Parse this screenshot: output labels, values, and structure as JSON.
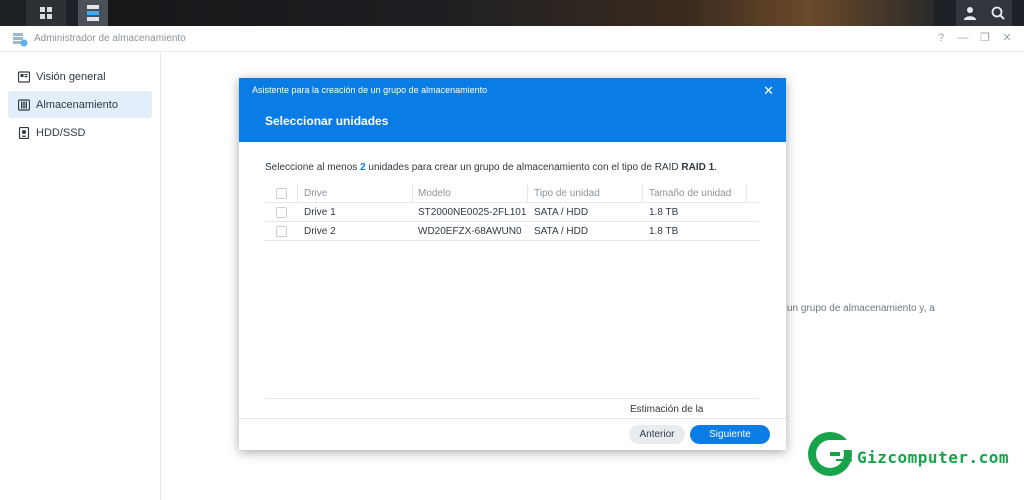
{
  "window": {
    "title": "Administrador de almacenamiento",
    "controls": [
      "?",
      "—",
      "❐",
      "✕"
    ]
  },
  "sidebar": {
    "items": [
      {
        "label": "Visión general",
        "icon": "overview-icon",
        "active": false
      },
      {
        "label": "Almacenamiento",
        "icon": "storage-icon",
        "active": true
      },
      {
        "label": "HDD/SSD",
        "icon": "disk-icon",
        "active": false
      }
    ]
  },
  "main": {
    "background_text": "un grupo de almacenamiento y, a"
  },
  "wizard": {
    "title": "Asistente para la creación de un grupo de almacenamiento",
    "step_title": "Seleccionar unidades",
    "instruction_prefix": "Seleccione al menos ",
    "instruction_count": "2",
    "instruction_middle": " unidades para crear un grupo de almacenamiento con el tipo de RAID ",
    "instruction_raid": "RAID 1",
    "instruction_suffix": ".",
    "columns": [
      "Drive",
      "Modelo",
      "Tipo de unidad",
      "Tamaño de unidad"
    ],
    "rows": [
      {
        "drive": "Drive 1",
        "model": "ST2000NE0025-2FL101",
        "type": "SATA / HDD",
        "size": "1.8 TB"
      },
      {
        "drive": "Drive 2",
        "model": "WD20EFZX-68AWUN0",
        "type": "SATA / HDD",
        "size": "1.8 TB"
      }
    ],
    "estimate_label": "Estimación de la",
    "prev_label": "Anterior",
    "next_label": "Siguiente"
  },
  "watermark": {
    "text": "Gizcomputer.com"
  },
  "colors": {
    "accent": "#0a7ce6",
    "taskbar": "#1e2226",
    "watermark": "#17a34a"
  }
}
